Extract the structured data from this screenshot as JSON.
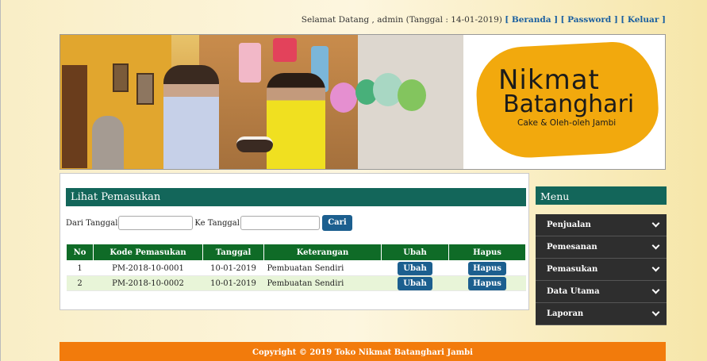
{
  "topbar": {
    "greeting": "Selamat Datang , admin (Tanggal : 14-01-2019)",
    "links": [
      {
        "label": "[ Beranda ]"
      },
      {
        "label": "[ Password ]"
      },
      {
        "label": "[ Keluar ]"
      }
    ]
  },
  "logo": {
    "line1": "Nikmat",
    "line2": "Batanghari",
    "tagline": "Cake & Oleh-oleh Jambi"
  },
  "content": {
    "title": "Lihat Pemasukan",
    "filter": {
      "from_label": "Dari Tanggal",
      "from_value": "",
      "to_label": "Ke Tanggal",
      "to_value": "",
      "search_button": "Cari"
    },
    "table": {
      "headers": [
        "No",
        "Kode Pemasukan",
        "Tanggal",
        "Keterangan",
        "Ubah",
        "Hapus"
      ],
      "rows": [
        {
          "no": "1",
          "kode": "PM-2018-10-0001",
          "tanggal": "10-01-2019",
          "keterangan": "Pembuatan Sendiri",
          "ubah": "Ubah",
          "hapus": "Hapus"
        },
        {
          "no": "2",
          "kode": "PM-2018-10-0002",
          "tanggal": "10-01-2019",
          "keterangan": "Pembuatan Sendiri",
          "ubah": "Ubah",
          "hapus": "Hapus"
        }
      ]
    }
  },
  "sidebar": {
    "title": "Menu",
    "items": [
      {
        "label": "Penjualan",
        "icon": "chevron-down-icon"
      },
      {
        "label": "Pemesanan",
        "icon": "chevron-down-icon"
      },
      {
        "label": "Pemasukan",
        "icon": "chevron-down-icon"
      },
      {
        "label": "Data Utama",
        "icon": "chevron-down-icon"
      },
      {
        "label": "Laporan",
        "icon": "chevron-down-icon"
      }
    ]
  },
  "footer": {
    "text": "Copyright © 2019 Toko Nikmat Batanghari Jambi"
  },
  "colors": {
    "header_green": "#13665a",
    "table_header_green": "#0f6b27",
    "button_blue": "#1c5f8f",
    "footer_orange": "#f27b0c",
    "logo_orange": "#f2a90d",
    "link_blue": "#1a5fa0"
  }
}
